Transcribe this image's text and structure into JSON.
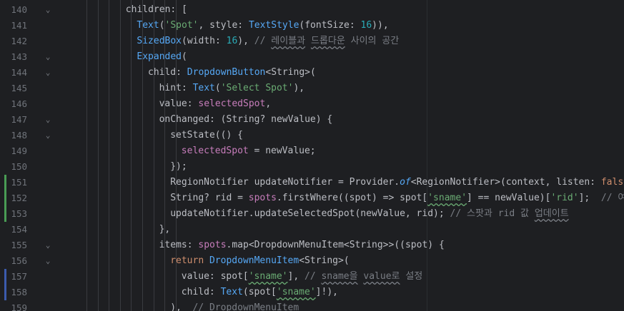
{
  "editor": {
    "lines": [
      {
        "n": "140",
        "fold": "v",
        "vcs": "",
        "indent": 3,
        "tokens": [
          [
            "plain",
            "children: ["
          ]
        ]
      },
      {
        "n": "141",
        "fold": "",
        "vcs": "",
        "indent": 4,
        "tokens": [
          [
            "type",
            "Text"
          ],
          [
            "plain",
            "("
          ],
          [
            "str",
            "'Spot'"
          ],
          [
            "plain",
            ", style: "
          ],
          [
            "type",
            "TextStyle"
          ],
          [
            "plain",
            "(fontSize: "
          ],
          [
            "num",
            "16"
          ],
          [
            "plain",
            "))"
          ],
          [
            "plain",
            ","
          ]
        ]
      },
      {
        "n": "142",
        "fold": "",
        "vcs": "",
        "indent": 4,
        "tokens": [
          [
            "type",
            "SizedBox"
          ],
          [
            "plain",
            "(width: "
          ],
          [
            "num",
            "16"
          ],
          [
            "plain",
            "), "
          ],
          [
            "com",
            "// "
          ],
          [
            "comw",
            "레이블과"
          ],
          [
            "com",
            " "
          ],
          [
            "comw",
            "드롭다운"
          ],
          [
            "com",
            " 사이의 공간"
          ]
        ]
      },
      {
        "n": "143",
        "fold": "v",
        "vcs": "",
        "indent": 4,
        "tokens": [
          [
            "type",
            "Expanded"
          ],
          [
            "plain",
            "("
          ]
        ]
      },
      {
        "n": "144",
        "fold": "v",
        "vcs": "",
        "indent": 5,
        "tokens": [
          [
            "plain",
            "child: "
          ],
          [
            "type",
            "DropdownButton"
          ],
          [
            "plain",
            "<String>("
          ]
        ]
      },
      {
        "n": "145",
        "fold": "",
        "vcs": "",
        "indent": 6,
        "tokens": [
          [
            "plain",
            "hint: "
          ],
          [
            "type",
            "Text"
          ],
          [
            "plain",
            "("
          ],
          [
            "str",
            "'Select Spot'"
          ],
          [
            "plain",
            "),"
          ]
        ]
      },
      {
        "n": "146",
        "fold": "",
        "vcs": "",
        "indent": 6,
        "tokens": [
          [
            "plain",
            "value: "
          ],
          [
            "fld",
            "selectedSpot"
          ],
          [
            "plain",
            ","
          ]
        ]
      },
      {
        "n": "147",
        "fold": "v",
        "vcs": "",
        "indent": 6,
        "tokens": [
          [
            "plain",
            "onChanged: (String? newValue) {"
          ]
        ]
      },
      {
        "n": "148",
        "fold": "v",
        "vcs": "",
        "indent": 7,
        "tokens": [
          [
            "plain",
            "setState(() {"
          ]
        ]
      },
      {
        "n": "149",
        "fold": "",
        "vcs": "",
        "indent": 8,
        "tokens": [
          [
            "fld",
            "selectedSpot"
          ],
          [
            "plain",
            " = newValue;"
          ]
        ]
      },
      {
        "n": "150",
        "fold": "",
        "vcs": "",
        "indent": 7,
        "tokens": [
          [
            "plain",
            "});"
          ]
        ]
      },
      {
        "n": "151",
        "fold": "",
        "vcs": "#499c54",
        "indent": 7,
        "tokens": [
          [
            "plain",
            "RegionNotifier updateNotifier = Provider."
          ],
          [
            "it",
            "of"
          ],
          [
            "plain",
            "<RegionNotifier>(context, listen: "
          ],
          [
            "kw",
            "false"
          ],
          [
            "plain",
            ");"
          ]
        ]
      },
      {
        "n": "152",
        "fold": "",
        "vcs": "#499c54",
        "indent": 7,
        "tokens": [
          [
            "plain",
            "String? rid = "
          ],
          [
            "fld",
            "spots"
          ],
          [
            "plain",
            ".firstWhere((spot) => spot["
          ],
          [
            "strw",
            "'sname'"
          ],
          [
            "plain",
            "] == newValue)["
          ],
          [
            "str",
            "'rid'"
          ],
          [
            "plain",
            "];  "
          ],
          [
            "com",
            "// 여기서 실제"
          ]
        ]
      },
      {
        "n": "153",
        "fold": "",
        "vcs": "#499c54",
        "indent": 7,
        "tokens": [
          [
            "plain",
            "updateNotifier.updateSelectedSpot(newValue, rid); "
          ],
          [
            "com",
            "// 스팟과 rid 값 "
          ],
          [
            "comw",
            "업데이트"
          ]
        ]
      },
      {
        "n": "154",
        "fold": "",
        "vcs": "",
        "indent": 6,
        "tokens": [
          [
            "plain",
            "},"
          ]
        ]
      },
      {
        "n": "155",
        "fold": "v",
        "vcs": "",
        "indent": 6,
        "tokens": [
          [
            "plain",
            "items: "
          ],
          [
            "fld",
            "spots"
          ],
          [
            "plain",
            ".map<DropdownMenuItem<String>>((spot) {"
          ]
        ]
      },
      {
        "n": "156",
        "fold": "v",
        "vcs": "",
        "indent": 7,
        "tokens": [
          [
            "kw",
            "return "
          ],
          [
            "type",
            "DropdownMenuItem"
          ],
          [
            "plain",
            "<String>("
          ]
        ]
      },
      {
        "n": "157",
        "fold": "",
        "vcs": "#3b5bad",
        "indent": 8,
        "tokens": [
          [
            "plain",
            "value: spot["
          ],
          [
            "strw",
            "'sname'"
          ],
          [
            "plain",
            "], "
          ],
          [
            "com",
            "// "
          ],
          [
            "comw",
            "sname을"
          ],
          [
            "com",
            " "
          ],
          [
            "comw",
            "value로"
          ],
          [
            "com",
            " 설정"
          ]
        ]
      },
      {
        "n": "158",
        "fold": "",
        "vcs": "#3b5bad",
        "indent": 8,
        "tokens": [
          [
            "plain",
            "child: "
          ],
          [
            "type",
            "Text"
          ],
          [
            "plain",
            "(spot["
          ],
          [
            "strw",
            "'sname'"
          ],
          [
            "plain",
            "]!),"
          ]
        ]
      },
      {
        "n": "159",
        "fold": "",
        "vcs": "",
        "indent": 7,
        "tokens": [
          [
            "plain",
            "),  "
          ],
          [
            "com",
            "// DropdownMenuItem"
          ]
        ]
      }
    ]
  }
}
